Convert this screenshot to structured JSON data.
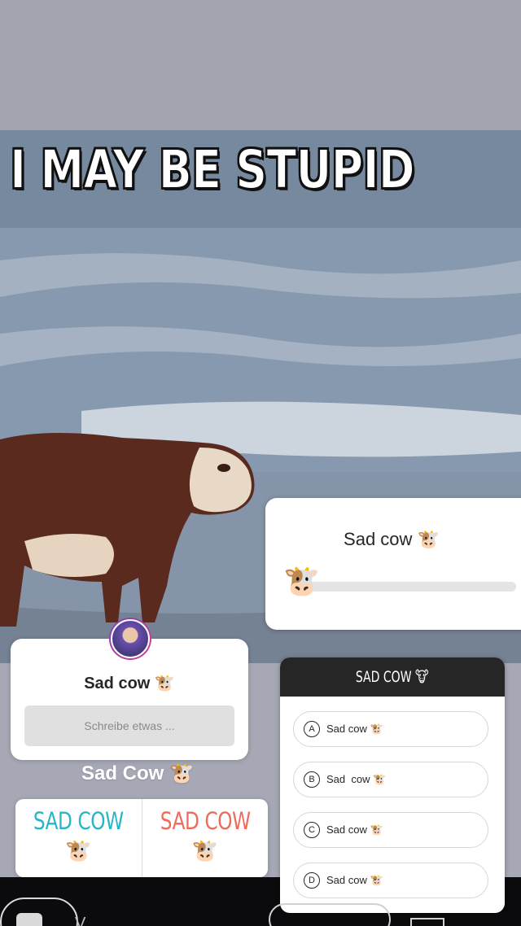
{
  "meme": {
    "caption": "I MAY BE STUPID"
  },
  "slider_sticker": {
    "title": "Sad cow 🐮",
    "thumb_emoji": "🐮",
    "value": 0.0
  },
  "question_sticker": {
    "title": "Sad cow 🐮",
    "placeholder": "Schreibe etwas ..."
  },
  "text_sticker": {
    "text": "Sad Cow 🐮"
  },
  "poll_sticker": {
    "options": [
      {
        "label": "SAD COW",
        "emoji": "🐮",
        "color": "#27b6c8"
      },
      {
        "label": "SAD COW",
        "emoji": "🐮",
        "color": "#f06a5a"
      }
    ]
  },
  "quiz_sticker": {
    "title": "SAD COW 🐮",
    "options": [
      {
        "letter": "A",
        "text": "Sad cow 🐮"
      },
      {
        "letter": "B",
        "text": "Sad  cow 🐮"
      },
      {
        "letter": "C",
        "text": "Sad cow 🐮"
      },
      {
        "letter": "D",
        "text": "Sad cow 🐮"
      }
    ]
  },
  "bottom_bar": {
    "partial_text": "V"
  }
}
